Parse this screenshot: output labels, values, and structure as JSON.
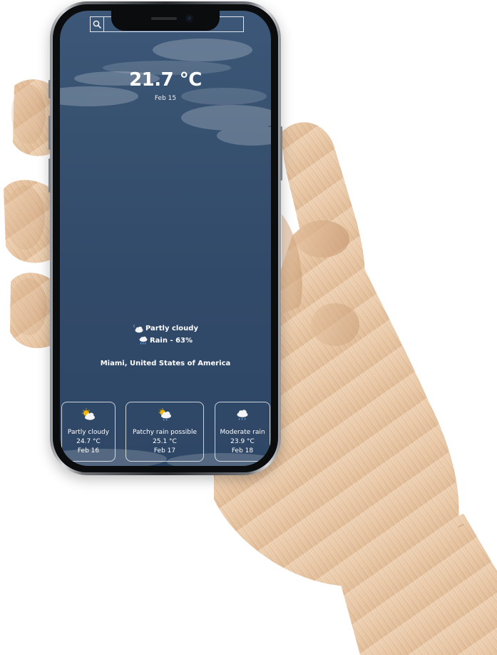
{
  "search": {
    "value": "",
    "placeholder": ""
  },
  "current": {
    "temperature": "21.7 °C",
    "date": "Feb 15",
    "condition": "Partly cloudy",
    "condition_icon": "partly-cloudy-night-icon",
    "rain": "Rain - 63%",
    "rain_icon": "rain-icon",
    "location": "Miami, United States of America"
  },
  "forecast": [
    {
      "condition": "Partly cloudy",
      "temperature": "24.7 °C",
      "date": "Feb 16",
      "icon": "partly-cloudy-icon"
    },
    {
      "condition": "Patchy rain possible",
      "temperature": "25.1 °C",
      "date": "Feb 17",
      "icon": "patchy-rain-icon"
    },
    {
      "condition": "Moderate rain",
      "temperature": "23.9 °C",
      "date": "Feb 18",
      "icon": "moderate-rain-icon"
    }
  ],
  "colors": {
    "screen_background": "#34506f",
    "text": "#ffffff",
    "sun": "#f4b400",
    "cloud": "#f2f4f7",
    "rain_drop": "#5aa0e6"
  }
}
